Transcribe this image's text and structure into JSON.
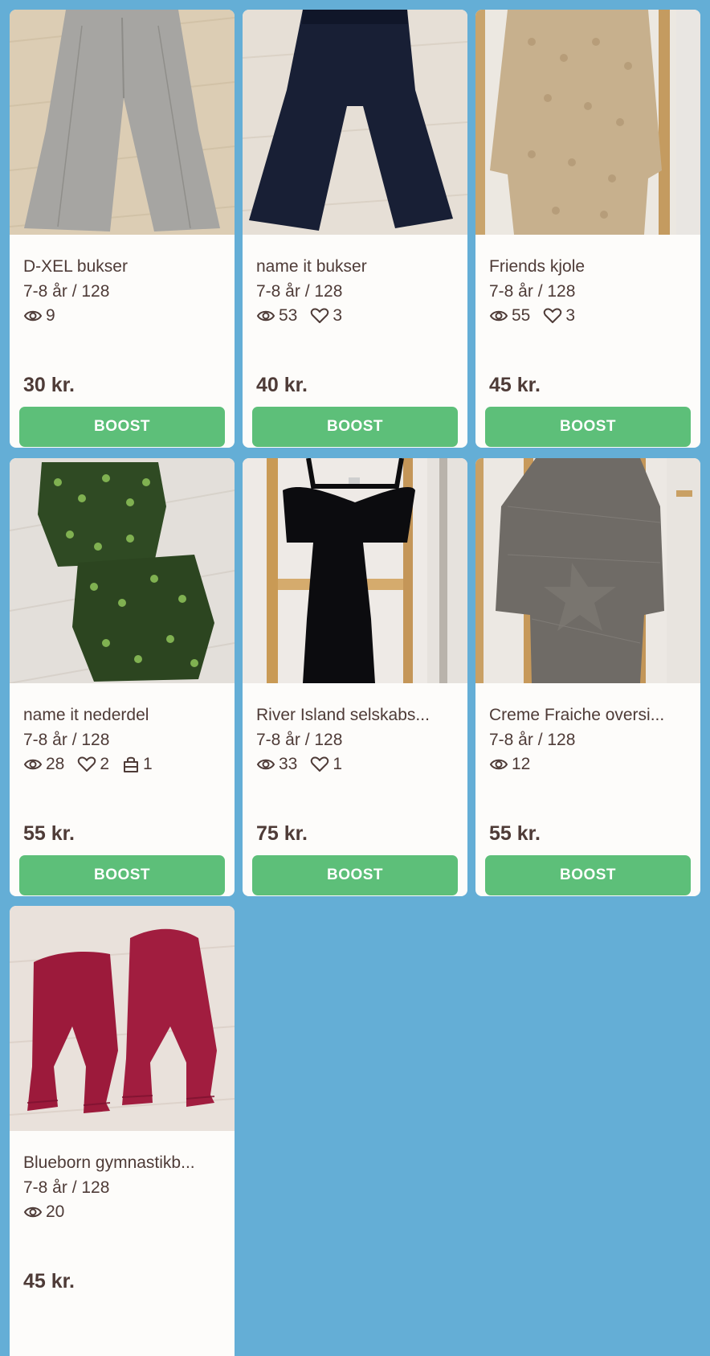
{
  "listings": [
    {
      "title": "D-XEL bukser",
      "size": "7-8 år / 128",
      "views": "9",
      "likes": null,
      "bag": null,
      "price": "30 kr.",
      "boost": "BOOST"
    },
    {
      "title": "name it bukser",
      "size": "7-8 år / 128",
      "views": "53",
      "likes": "3",
      "bag": null,
      "price": "40 kr.",
      "boost": "BOOST"
    },
    {
      "title": "Friends kjole",
      "size": "7-8 år / 128",
      "views": "55",
      "likes": "3",
      "bag": null,
      "price": "45 kr.",
      "boost": "BOOST"
    },
    {
      "title": "name it nederdel",
      "size": "7-8 år / 128",
      "views": "28",
      "likes": "2",
      "bag": "1",
      "price": "55 kr.",
      "boost": "BOOST"
    },
    {
      "title": "River Island selskabs...",
      "size": "7-8 år / 128",
      "views": "33",
      "likes": "1",
      "bag": null,
      "price": "75 kr.",
      "boost": "BOOST"
    },
    {
      "title": "Creme Fraiche oversi...",
      "size": "7-8 år / 128",
      "views": "12",
      "likes": null,
      "bag": null,
      "price": "55 kr.",
      "boost": "BOOST"
    },
    {
      "title": "Blueborn gymnastikb...",
      "size": "7-8 år / 128",
      "views": "20",
      "likes": null,
      "bag": null,
      "price": "45 kr.",
      "boost": null
    }
  ],
  "icons": {
    "views": "eye-icon",
    "likes": "heart-icon",
    "bag": "shopping-bag-icon"
  },
  "colors": {
    "background": "#64aed6",
    "boost": "#5dbf79",
    "text": "#4e3b37"
  }
}
